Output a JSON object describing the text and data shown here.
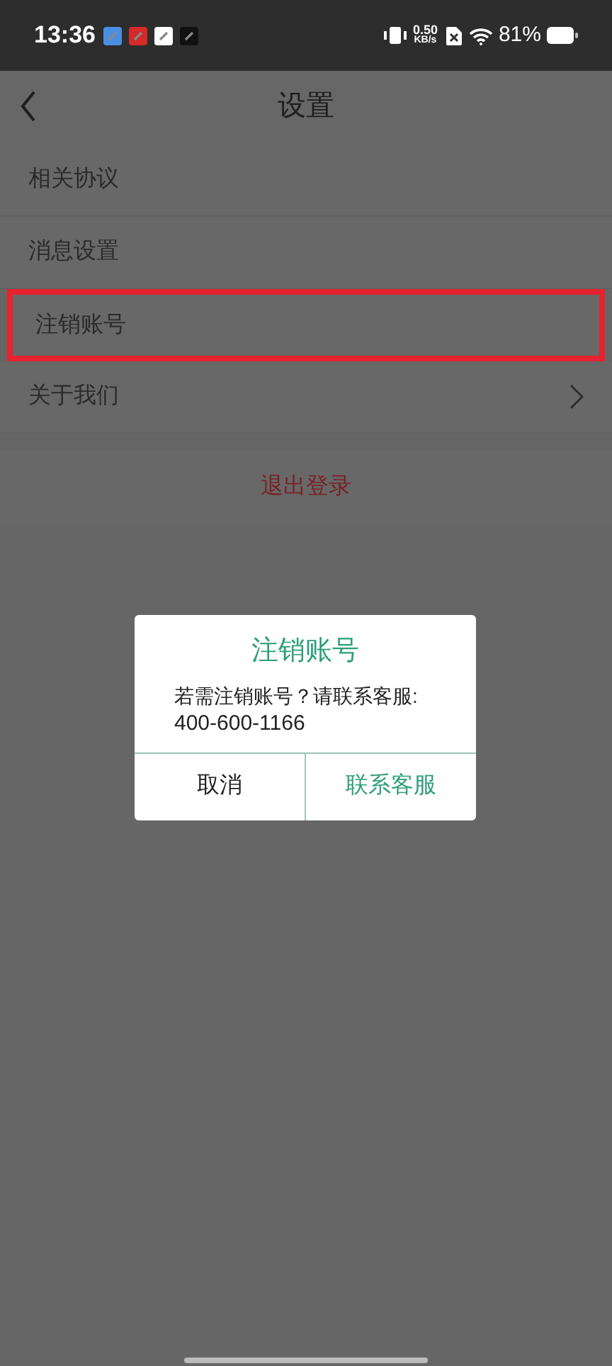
{
  "status_bar": {
    "time": "13:36",
    "app_icons": [
      {
        "color": "#4a8fe0"
      },
      {
        "color": "#d42a2a"
      },
      {
        "color": "#ffffff"
      },
      {
        "color": "#111111"
      }
    ],
    "speed_value": "0.50",
    "speed_unit": "KB/s",
    "battery": "81%"
  },
  "header": {
    "title": "设置"
  },
  "settings": [
    {
      "label": "相关协议",
      "arrow": false,
      "highlighted": false
    },
    {
      "label": "消息设置",
      "arrow": false,
      "highlighted": false
    },
    {
      "label": "注销账号",
      "arrow": false,
      "highlighted": true
    },
    {
      "label": "关于我们",
      "arrow": true,
      "highlighted": false
    }
  ],
  "logout": "退出登录",
  "dialog": {
    "title": "注销账号",
    "message": "若需注销账号？请联系客服:",
    "phone": "400-600-1166",
    "buttons": [
      {
        "label": "取消",
        "kind": "cancel"
      },
      {
        "label": "联系客服",
        "kind": "confirm"
      }
    ]
  }
}
